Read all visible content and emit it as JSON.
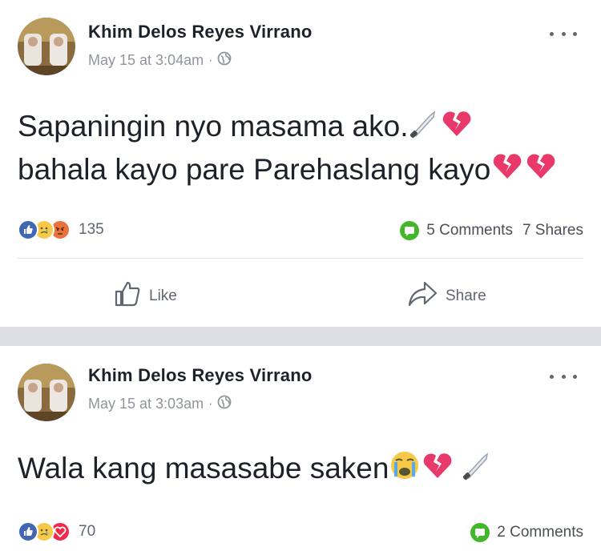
{
  "posts": [
    {
      "author": "Khim Delos Reyes Virrano",
      "timestamp": "May 15 at 3:04am",
      "privacy_icon": "globe-icon",
      "text_line1": "Sapaningin nyo masama ako.",
      "text_line2": "bahala kayo pare Parehaslang kayo",
      "reactions": [
        "like",
        "sad",
        "angry"
      ],
      "reaction_count": "135",
      "comments_label": "5 Comments",
      "shares_label": "7 Shares",
      "like_label": "Like",
      "share_label": "Share"
    },
    {
      "author": "Khim Delos Reyes Virrano",
      "timestamp": "May 15 at 3:03am",
      "privacy_icon": "globe-icon",
      "text_line1": "Wala kang masasabe saken",
      "reactions": [
        "like",
        "sad",
        "love"
      ],
      "reaction_count": "70",
      "comments_label": "2 Comments"
    }
  ],
  "colors": {
    "like_blue": "#4267b2",
    "sad_yellow": "#f7c948",
    "angry_orange": "#e9713c",
    "love_red": "#f0284a",
    "comment_green": "#42b72a",
    "heart_pink": "#e8396a"
  }
}
